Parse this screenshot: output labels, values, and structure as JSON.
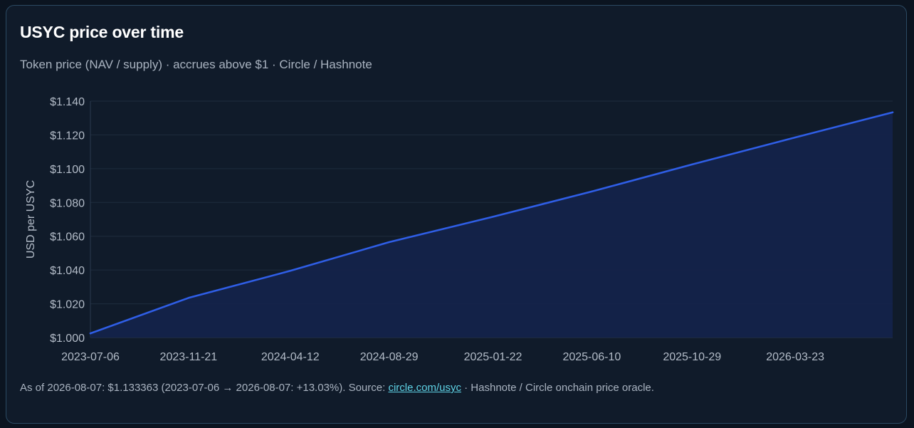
{
  "card": {
    "title": "USYC price over time",
    "subtitle": "Token price (NAV / supply) · accrues above $1 · Circle / Hashnote"
  },
  "footnote": {
    "prefix": "As of 2026-08-07: $1.133363 (2023-07-06 → 2026-08-07: +13.03%). Source: ",
    "link_text": "circle.com/usyc",
    "suffix": " · Hashnote / Circle onchain price oracle."
  },
  "colors": {
    "line": "#2f5ee6",
    "area": "#14234a",
    "grid": "#1e2c3e",
    "axis": "#2a3a4e"
  },
  "chart_data": {
    "type": "area",
    "ylabel": "USD per USYC",
    "xlabel": "",
    "ylim": [
      1.0,
      1.14
    ],
    "y_ticks": [
      1.0,
      1.02,
      1.04,
      1.06,
      1.08,
      1.1,
      1.12,
      1.14
    ],
    "y_tick_labels": [
      "$1.000",
      "$1.020",
      "$1.040",
      "$1.060",
      "$1.080",
      "$1.100",
      "$1.120",
      "$1.140"
    ],
    "xlim": [
      "2023-07-06",
      "2026-08-07"
    ],
    "x_ticks": [
      "2023-07-06",
      "2023-11-21",
      "2024-04-12",
      "2024-08-29",
      "2025-01-22",
      "2025-06-10",
      "2025-10-29",
      "2026-03-23"
    ],
    "grid": true,
    "series": [
      {
        "x": [
          "2023-07-06",
          "2023-11-21",
          "2024-04-12",
          "2024-08-29",
          "2025-01-22",
          "2025-06-10",
          "2025-10-29",
          "2026-03-23",
          "2026-08-07"
        ],
        "y": [
          1.0025,
          1.0235,
          1.0395,
          1.0565,
          1.0715,
          1.0865,
          1.1025,
          1.1185,
          1.1334
        ]
      }
    ]
  }
}
